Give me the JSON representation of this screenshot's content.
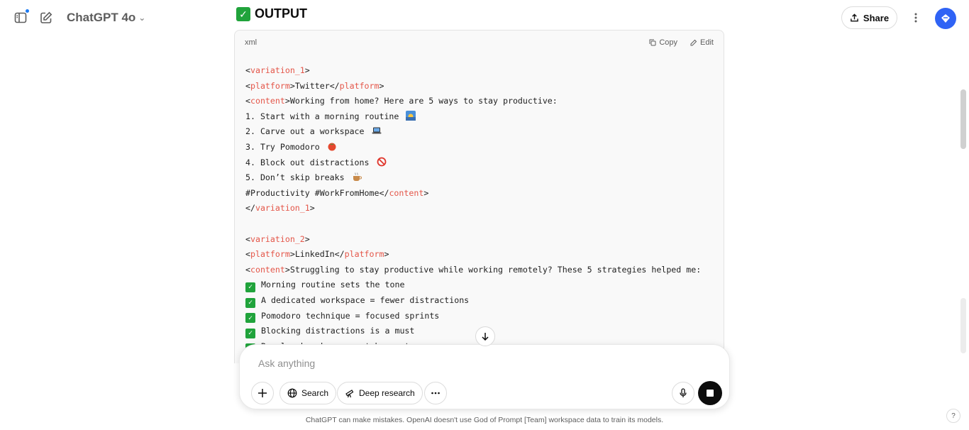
{
  "header": {
    "model_name": "ChatGPT 4o",
    "share_label": "Share"
  },
  "message": {
    "heading": "OUTPUT"
  },
  "code_block": {
    "language": "xml",
    "copy_label": "Copy",
    "edit_label": "Edit",
    "variation1": {
      "open_tag": "variation_1",
      "platform_tag": "platform",
      "platform": "Twitter",
      "content_tag": "content",
      "intro": "Working from home? Here are 5 ways to stay productive:",
      "items": [
        "1. Start with a morning routine",
        "2. Carve out a workspace",
        "3. Try Pomodoro",
        "4. Block out distractions",
        "5. Don’t skip breaks"
      ],
      "hashtags": "#Productivity #WorkFromHome"
    },
    "variation2": {
      "open_tag": "variation_2",
      "platform_tag": "platform",
      "platform": "LinkedIn",
      "content_tag": "content",
      "intro": "Struggling to stay productive while working remotely? These 5 strategies helped me:",
      "items": [
        "Morning routine sets the tone",
        "A dedicated workspace = fewer distractions",
        "Pomodoro technique = focused sprints",
        "Blocking distractions is a must",
        "Regular breaks prevent burnout"
      ]
    }
  },
  "composer": {
    "placeholder": "Ask anything",
    "search_label": "Search",
    "research_label": "Deep research"
  },
  "footer": {
    "disclaimer": "ChatGPT can make mistakes. OpenAI doesn't use God of Prompt [Team] workspace data to train its models.",
    "help": "?"
  },
  "icons": {
    "sidebar": "sidebar-toggle-icon",
    "new_chat": "compose-icon",
    "share": "share-icon",
    "more": "more-vertical-icon",
    "avatar": "workspace-avatar-icon",
    "copy": "copy-icon",
    "edit": "edit-icon",
    "scroll": "arrow-down-icon",
    "plus": "plus-icon",
    "globe": "globe-icon",
    "telescope": "telescope-icon",
    "tools": "more-horizontal-icon",
    "mic": "microphone-icon",
    "stop": "stop-icon"
  },
  "colors": {
    "accent_blue": "#2f63f5",
    "check_green": "#20a33b",
    "xml_tag": "#e45649"
  }
}
